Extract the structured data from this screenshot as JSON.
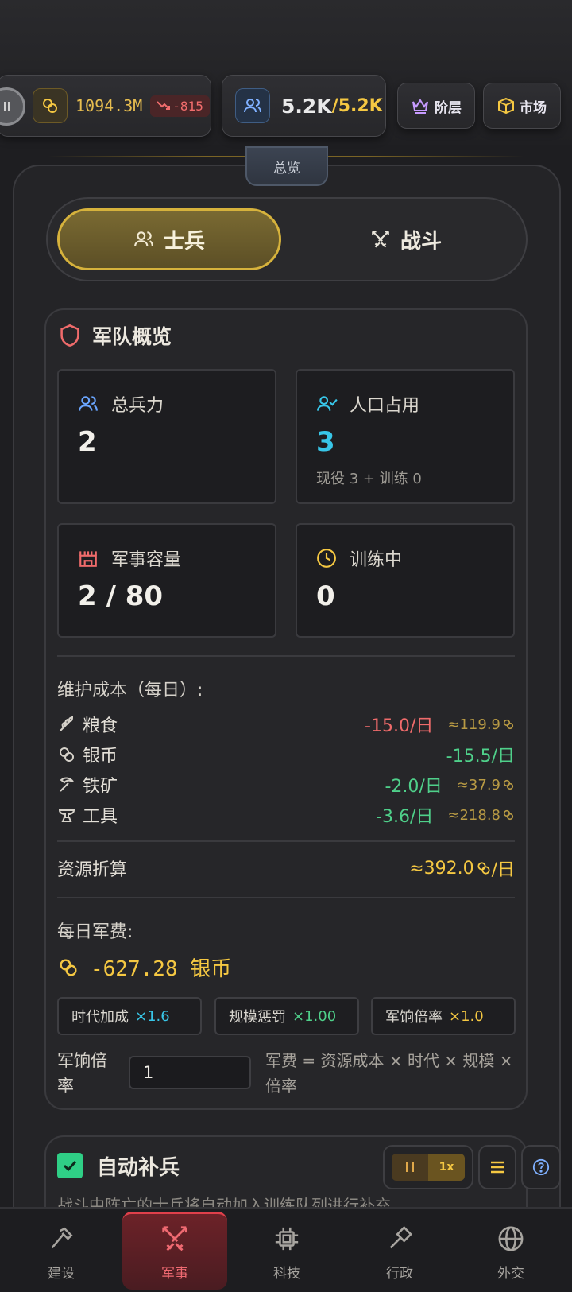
{
  "header": {
    "silver": {
      "icon": "coins-icon",
      "value": "1094.3M",
      "change": "-815"
    },
    "population": {
      "icon": "users-icon",
      "current": "5.2K",
      "max": "/5.2K"
    },
    "class_button": {
      "icon": "crown-icon",
      "label": "阶层"
    },
    "market_button": {
      "icon": "box-icon",
      "label": "市场"
    },
    "overview_tab": "总览"
  },
  "tabs": [
    {
      "icon": "users-icon",
      "label": "士兵",
      "active": true
    },
    {
      "icon": "crossed-swords-icon",
      "label": "战斗",
      "active": false
    }
  ],
  "army": {
    "title": "军队概览",
    "stats": {
      "total": {
        "label": "总兵力",
        "value": "2"
      },
      "population": {
        "label": "人口占用",
        "value": "3",
        "sub": "现役 3 + 训练 0"
      },
      "capacity": {
        "label": "军事容量",
        "value": "2 / 80"
      },
      "training": {
        "label": "训练中",
        "value": "0"
      }
    },
    "upkeep_title": "维护成本（每日）:",
    "upkeep": [
      {
        "icon": "wheat-icon",
        "label": "粮食",
        "rate": "-15.0/日",
        "approx": "≈119.9"
      },
      {
        "icon": "coins-icon",
        "label": "银币",
        "rate": "-15.5/日",
        "approx": ""
      },
      {
        "icon": "pickaxe-icon",
        "label": "铁矿",
        "rate": "-2.0/日",
        "approx": "≈37.9"
      },
      {
        "icon": "anvil-icon",
        "label": "工具",
        "rate": "-3.6/日",
        "approx": "≈218.8"
      }
    ],
    "conversion_label": "资源折算",
    "conversion_value": "≈392.0",
    "per_day": "/日",
    "daily_title": "每日军费:",
    "daily_value": "-627.28 银币",
    "chips": [
      {
        "label": "时代加成",
        "value": "×1.6"
      },
      {
        "label": "规模惩罚",
        "value": "×1.00"
      },
      {
        "label": "军饷倍率",
        "value": "×1.0"
      }
    ],
    "pay_label": "军饷倍率",
    "pay_input": "1",
    "formula": "军费 = 资源成本 × 时代 × 规模 × 倍率"
  },
  "auto": {
    "title": "自动补兵",
    "checked": true,
    "desc": "战斗中阵亡的士兵将自动加入训练队列进行补充"
  },
  "speed": {
    "label": "1x"
  },
  "nav": [
    {
      "icon": "hammer-icon",
      "label": "建设"
    },
    {
      "icon": "crossed-swords-icon",
      "label": "军事",
      "active": true
    },
    {
      "icon": "chip-icon",
      "label": "科技"
    },
    {
      "icon": "gavel-icon",
      "label": "行政"
    },
    {
      "icon": "globe-icon",
      "label": "外交"
    }
  ],
  "colors": {
    "gold": "#f5c842",
    "red": "#ef6b6b",
    "green": "#4fd08a",
    "cyan": "#38c6e8",
    "accent_red": "#c8323c"
  }
}
